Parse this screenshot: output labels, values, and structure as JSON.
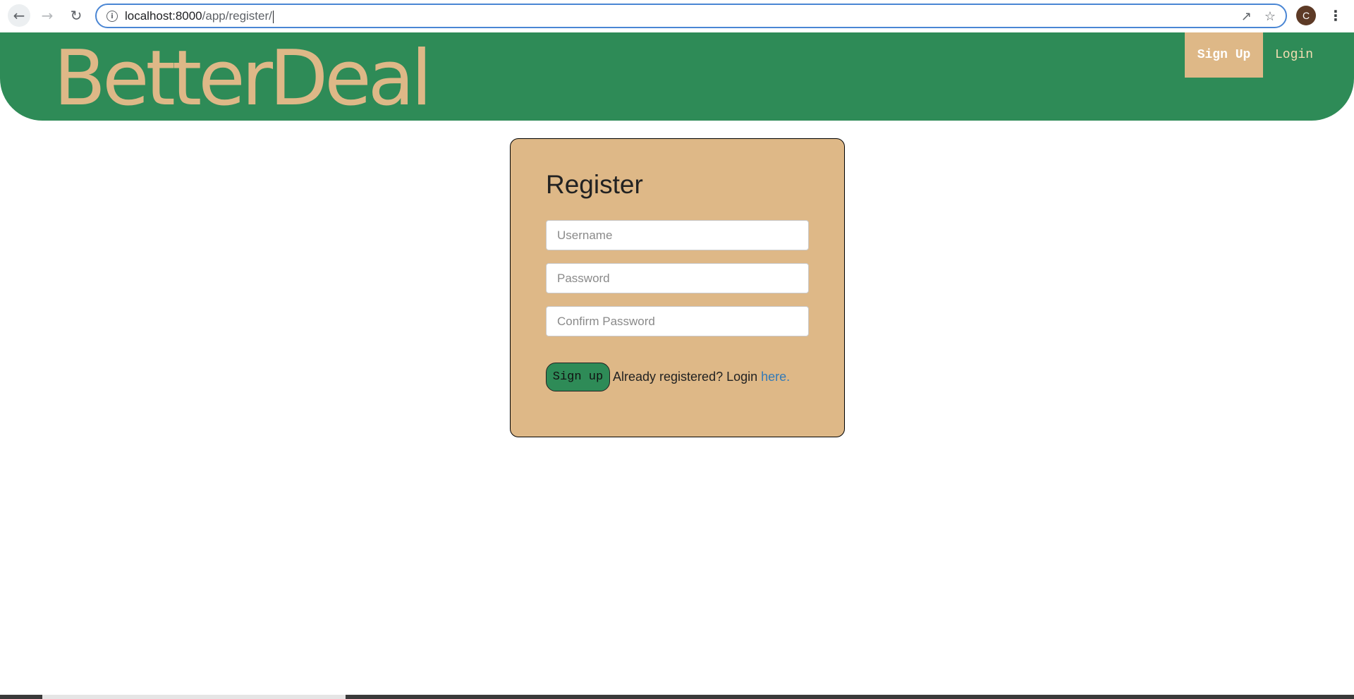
{
  "browser": {
    "url_host": "localhost:8000",
    "url_path": "/app/register/",
    "avatar_letter": "C",
    "icons": [
      "back-icon",
      "forward-icon",
      "reload-icon",
      "info-icon",
      "share-icon",
      "star-icon",
      "menu-icon"
    ]
  },
  "header": {
    "brand": "BetterDeal",
    "nav": {
      "signup_label": "Sign Up",
      "login_label": "Login"
    }
  },
  "register": {
    "title": "Register",
    "username_placeholder": "Username",
    "password_placeholder": "Password",
    "confirm_placeholder": "Confirm Password",
    "submit_label": "Sign up",
    "already_text": "Already registered? Login ",
    "here_link": "here."
  },
  "colors": {
    "header_green": "#2e8b57",
    "tan": "#deb887",
    "link_blue": "#337ab7"
  }
}
